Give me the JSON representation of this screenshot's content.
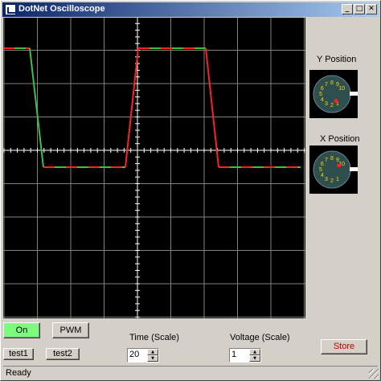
{
  "window": {
    "title": "DotNet Oscilloscope",
    "minimize_label": "_",
    "maximize_label": "□",
    "close_label": "✕"
  },
  "knobs": {
    "y_label": "Y Position",
    "x_label": "X Position",
    "dial_numbers": [
      "1",
      "2",
      "3",
      "4",
      "5",
      "6",
      "7",
      "8",
      "9",
      "10"
    ],
    "y_value": 1,
    "x_value": 10
  },
  "controls": {
    "on_label": "On",
    "pwm_label": "PWM",
    "test1_label": "test1",
    "test2_label": "test2",
    "time_label": "Time  (Scale)",
    "time_value": "20",
    "voltage_label": "Voltage (Scale)",
    "voltage_value": "1",
    "store_label": "Store"
  },
  "status": {
    "text": "Ready"
  },
  "colors": {
    "trace_red": "#ff2020",
    "trace_green": "#40c040",
    "grid": "#808080",
    "on_button": "#7cfc7c",
    "knob_face": "#2f4f4f",
    "knob_numbers": "#ffd700"
  }
}
